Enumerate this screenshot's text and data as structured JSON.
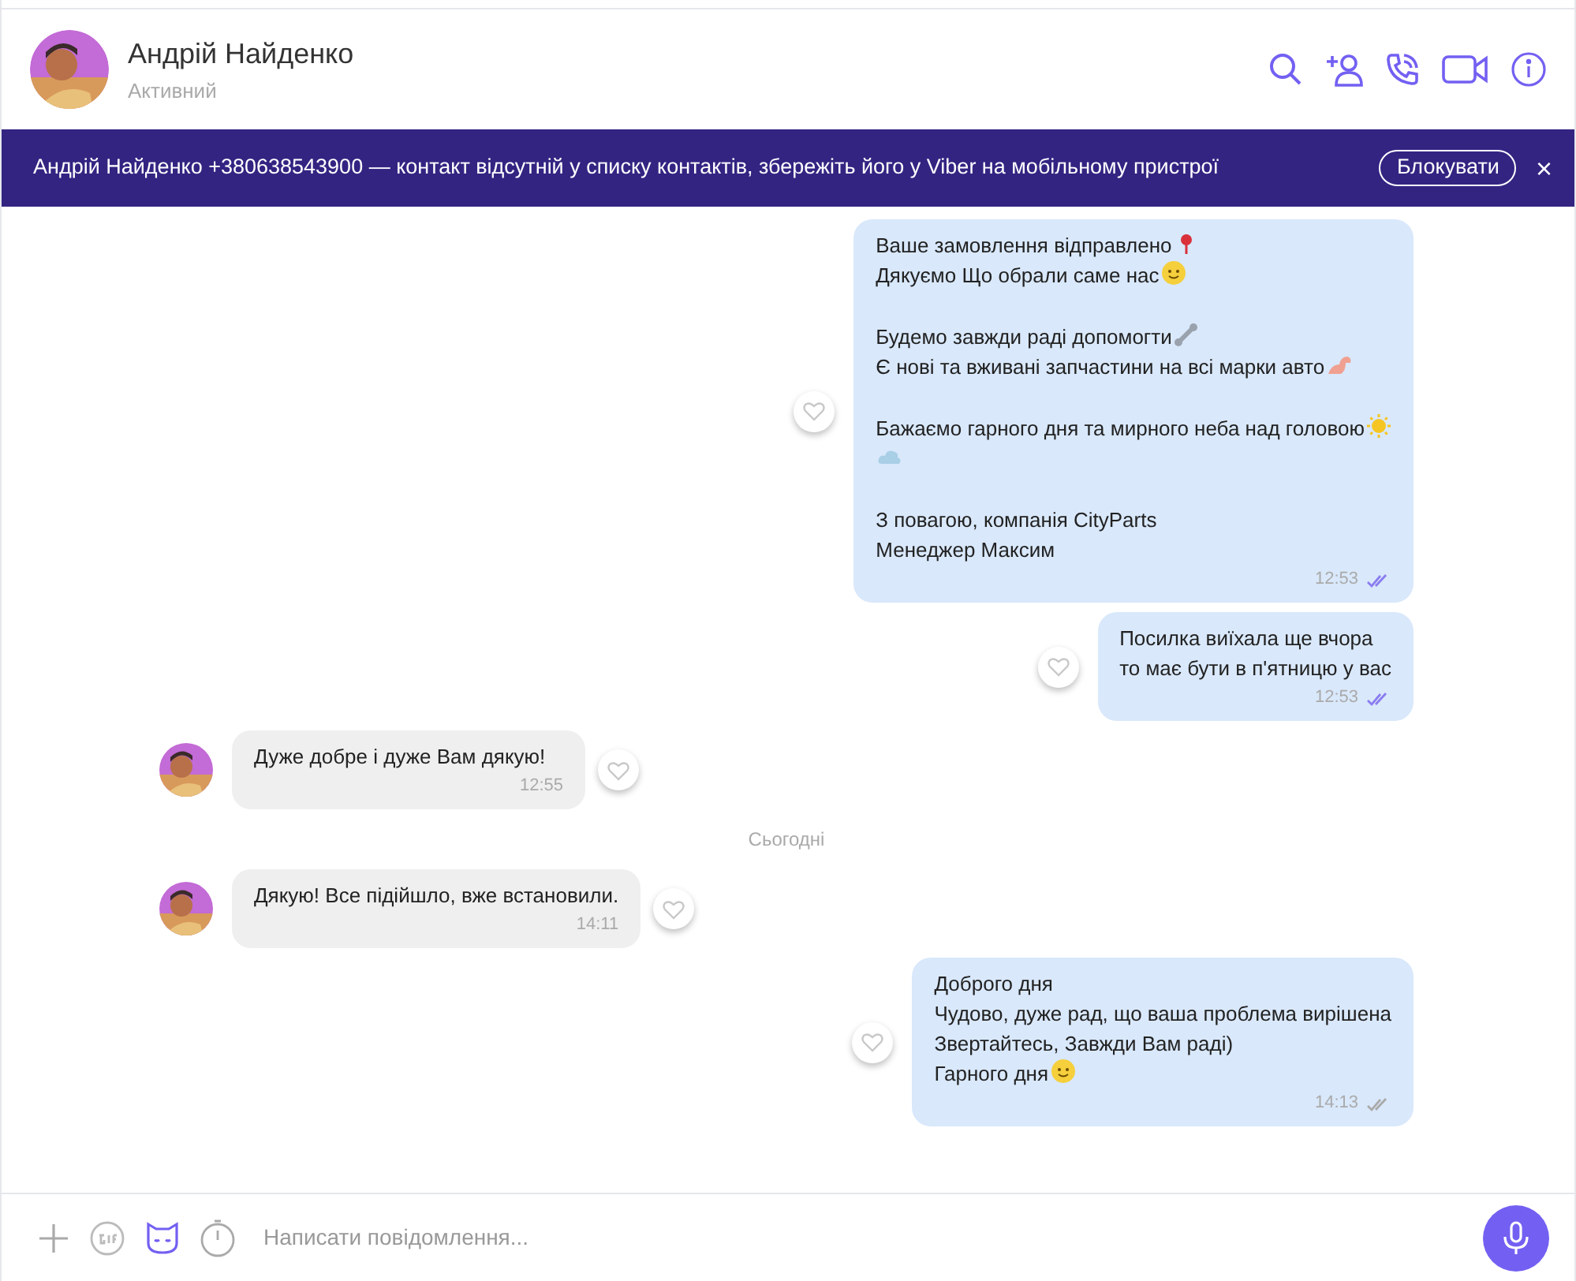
{
  "header": {
    "name": "Андрій Найденко",
    "status": "Активний"
  },
  "banner": {
    "text": "Андрій Найденко +380638543900 — контакт відсутній у списку контактів, збережіть його у Viber на мобільному пристрої",
    "button": "Блокувати",
    "close": "×"
  },
  "messages": [
    {
      "kind": "outgoing",
      "time": "12:53",
      "read": true,
      "lines": [
        {
          "text": "Ваше замовлення відправлено",
          "kind": "pin"
        },
        {
          "text": "Дякуємо Що обрали саме нас",
          "kind": "smile"
        },
        {
          "kind": "blank"
        },
        {
          "text": "Будемо завжди раді допомогти",
          "kind": "wrench"
        },
        {
          "text": "Є нові та вживані запчастини на всі марки авто",
          "kind": "muscle"
        },
        {
          "kind": "blank"
        },
        {
          "text": "Бажаємо гарного дня та мирного неба над головою",
          "kind": "sun"
        },
        {
          "kind": "cloud"
        },
        {
          "kind": "blank"
        },
        {
          "text": "З повагою, компанія CityParts",
          "kind": "plain"
        },
        {
          "text": "Менеджер Максим",
          "kind": "plain"
        }
      ]
    },
    {
      "kind": "outgoing",
      "time": "12:53",
      "read": true,
      "lines": [
        {
          "text": "Посилка виїхала ще вчора",
          "kind": "plain"
        },
        {
          "text": "то має бути в п'ятницю у вас",
          "kind": "plain"
        }
      ]
    },
    {
      "kind": "incoming",
      "time": "12:55",
      "lines": [
        {
          "text": "Дуже добре і дуже Вам дякую!",
          "kind": "plain"
        }
      ]
    },
    {
      "kind": "date",
      "text": "Сьогодні"
    },
    {
      "kind": "incoming",
      "time": "14:11",
      "lines": [
        {
          "text": "Дякую! Все підійшло, вже встановили.",
          "kind": "plain"
        }
      ]
    },
    {
      "kind": "outgoing",
      "time": "14:13",
      "read": false,
      "lines": [
        {
          "text": "Доброго дня",
          "kind": "plain"
        },
        {
          "text": "Чудово, дуже рад, що ваша проблема вирішена",
          "kind": "plain"
        },
        {
          "text": "Звертайтесь, Завжди Вам раді)",
          "kind": "plain"
        },
        {
          "text": "Гарного дня",
          "kind": "smile"
        }
      ]
    }
  ],
  "composer": {
    "placeholder": "Написати повідомлення..."
  }
}
